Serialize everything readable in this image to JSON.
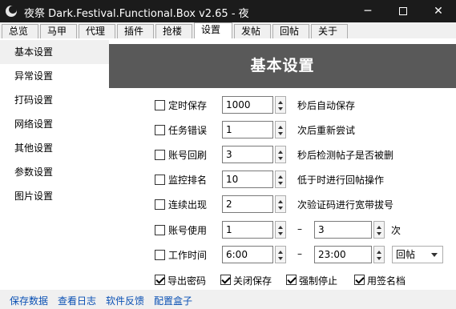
{
  "window": {
    "title": "夜祭 Dark.Festival.Functional.Box v2.65 - 夜",
    "minimize": "─",
    "close": "✕"
  },
  "tabs": [
    {
      "label": "总览"
    },
    {
      "label": "马甲"
    },
    {
      "label": "代理"
    },
    {
      "label": "插件"
    },
    {
      "label": "抢楼"
    },
    {
      "label": "设置"
    },
    {
      "label": "发帖"
    },
    {
      "label": "回帖"
    },
    {
      "label": "关于"
    }
  ],
  "nav": {
    "items": [
      {
        "label": "基本设置"
      },
      {
        "label": "异常设置"
      },
      {
        "label": "打码设置"
      },
      {
        "label": "网络设置"
      },
      {
        "label": "其他设置"
      },
      {
        "label": "参数设置"
      },
      {
        "label": "图片设置"
      }
    ],
    "selected": "基本设置"
  },
  "header": {
    "title": "基本设置"
  },
  "settings": [
    {
      "label": "定时保存",
      "checked": false,
      "value": "1000",
      "suffix": "秒后自动保存"
    },
    {
      "label": "任务错误",
      "checked": false,
      "value": "1",
      "suffix": "次后重新尝试"
    },
    {
      "label": "账号回刷",
      "checked": false,
      "value": "3",
      "suffix": "秒后检测帖子是否被删"
    },
    {
      "label": "监控排名",
      "checked": false,
      "value": "10",
      "suffix": "低于时进行回帖操作"
    },
    {
      "label": "连续出现",
      "checked": false,
      "value": "2",
      "suffix": "次验证码进行宽带拔号"
    },
    {
      "label": "账号使用",
      "checked": false,
      "value": "1",
      "dash": "–",
      "value2": "3",
      "suffix": "次"
    },
    {
      "label": "工作时间",
      "checked": false,
      "value": "6:00",
      "dash": "–",
      "value2": "23:00",
      "select": "回帖"
    }
  ],
  "options": [
    {
      "label": "导出密码",
      "checked": true
    },
    {
      "label": "关闭保存",
      "checked": true
    },
    {
      "label": "强制停止",
      "checked": true
    },
    {
      "label": "用签名档",
      "checked": true
    }
  ],
  "footer": {
    "links": [
      {
        "label": "保存数据"
      },
      {
        "label": "查看日志"
      },
      {
        "label": "软件反馈"
      },
      {
        "label": "配置盒子"
      }
    ]
  },
  "colors": {
    "titlebar": "#1b1b1b",
    "header_band": "#595959",
    "link": "#0a50b4",
    "panel": "#ffffff",
    "chrome": "#f0f0f0"
  }
}
